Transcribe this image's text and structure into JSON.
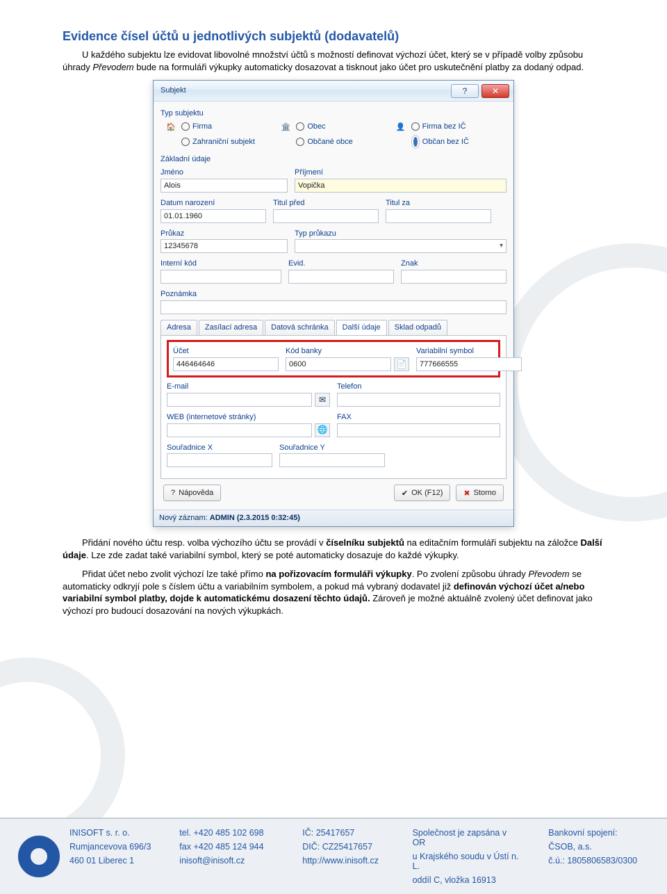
{
  "heading": "Evidence čísel účtů u jednotlivých subjektů (dodavatelů)",
  "para1_a": "U každého subjektu lze evidovat libovolné množství účtů s možností definovat výchozí účet, který se v případě volby způsobu úhrady ",
  "para1_em": "Převodem",
  "para1_b": " bude na formuláři výkupky automaticky dosazovat a tisknout jako účet pro uskutečnění platby za dodaný odpad.",
  "dialog": {
    "title": "Subjekt",
    "help_symbol": "?",
    "close_symbol": "✕",
    "type_section": "Typ subjektu",
    "radios": {
      "firma": "Firma",
      "obec": "Obec",
      "firma_bez_ic": "Firma bez IČ",
      "zahranicni": "Zahraniční subjekt",
      "obcane": "Občané obce",
      "obcan_bez_ic": "Občan bez IČ"
    },
    "basic_section": "Základní údaje",
    "labels": {
      "jmeno": "Jméno",
      "prijmeni": "Příjmení",
      "datum_narozeni": "Datum narození",
      "titul_pred": "Titul před",
      "titul_za": "Titul za",
      "prukaz": "Průkaz",
      "typ_prukazu": "Typ průkazu",
      "interni_kod": "Interní kód",
      "evid": "Evid.",
      "znak": "Znak",
      "poznamka": "Poznámka",
      "ucet": "Účet",
      "kod_banky": "Kód banky",
      "var_symbol": "Variabilní symbol",
      "email": "E-mail",
      "telefon": "Telefon",
      "web": "WEB (internetové stránky)",
      "fax": "FAX",
      "sx": "Souřadnice X",
      "sy": "Souřadnice Y"
    },
    "values": {
      "jmeno": "Alois",
      "prijmeni": "Vopička",
      "datum_narozeni": "01.01.1960",
      "prukaz": "12345678",
      "ucet": "446464646",
      "kod_banky": "0600",
      "var_symbol": "777666555"
    },
    "tabs": {
      "adresa": "Adresa",
      "zasilaci": "Zasílací adresa",
      "datova": "Datová schránka",
      "dalsi": "Další údaje",
      "sklad": "Sklad odpadů"
    },
    "buttons": {
      "napoveda": "Nápověda",
      "ok": "OK (F12)",
      "storno": "Storno"
    },
    "status_prefix": "Nový záznam: ",
    "status_bold": "ADMIN (2.3.2015 0:32:45)"
  },
  "para2_a": "Přidání nového účtu resp. volba výchozího účtu se provádí v ",
  "para2_b1": "číselníku subjektů",
  "para2_b": " na editačním formuláři subjektu na záložce ",
  "para2_b2": "Další údaje",
  "para2_c": ". Lze zde zadat také variabilní symbol, který se poté automaticky dosazuje do každé výkupky.",
  "para3_a": "Přidat účet nebo zvolit výchozí lze také přímo ",
  "para3_b1": "na pořizovacím formuláři výkupky",
  "para3_b": ". Po zvolení způsobu úhrady ",
  "para3_em": "Převodem",
  "para3_c": " se automaticky odkryjí pole s číslem účtu a variabilním symbolem, a pokud má vybraný dodavatel již ",
  "para3_b2": "definován výchozí účet a/nebo variabilní symbol platby, dojde k automatickému dosazení těchto údajů.",
  "para3_d": " Zároveň je možné aktuálně zvolený účet definovat jako výchozí pro budoucí dosazování na nových výkupkách.",
  "footer": {
    "c1": {
      "a": "INISOFT s. r. o.",
      "b": "Rumjancevova 696/3",
      "c": "460 01  Liberec 1"
    },
    "c2": {
      "a": "tel. +420 485 102 698",
      "b": "fax +420 485 124 944",
      "c": "inisoft@inisoft.cz"
    },
    "c3": {
      "a": "IČ: 25417657",
      "b": "DIČ: CZ25417657",
      "c": "http://www.inisoft.cz"
    },
    "c4": {
      "a": "Společnost je zapsána v OR",
      "b": "u Krajského soudu v Ústí n. L.",
      "c": "oddíl C, vložka 16913"
    },
    "c5": {
      "a": "Bankovní spojení:",
      "b": "ČSOB, a.s.",
      "c": "č.ú.: 1805806583/0300"
    }
  }
}
